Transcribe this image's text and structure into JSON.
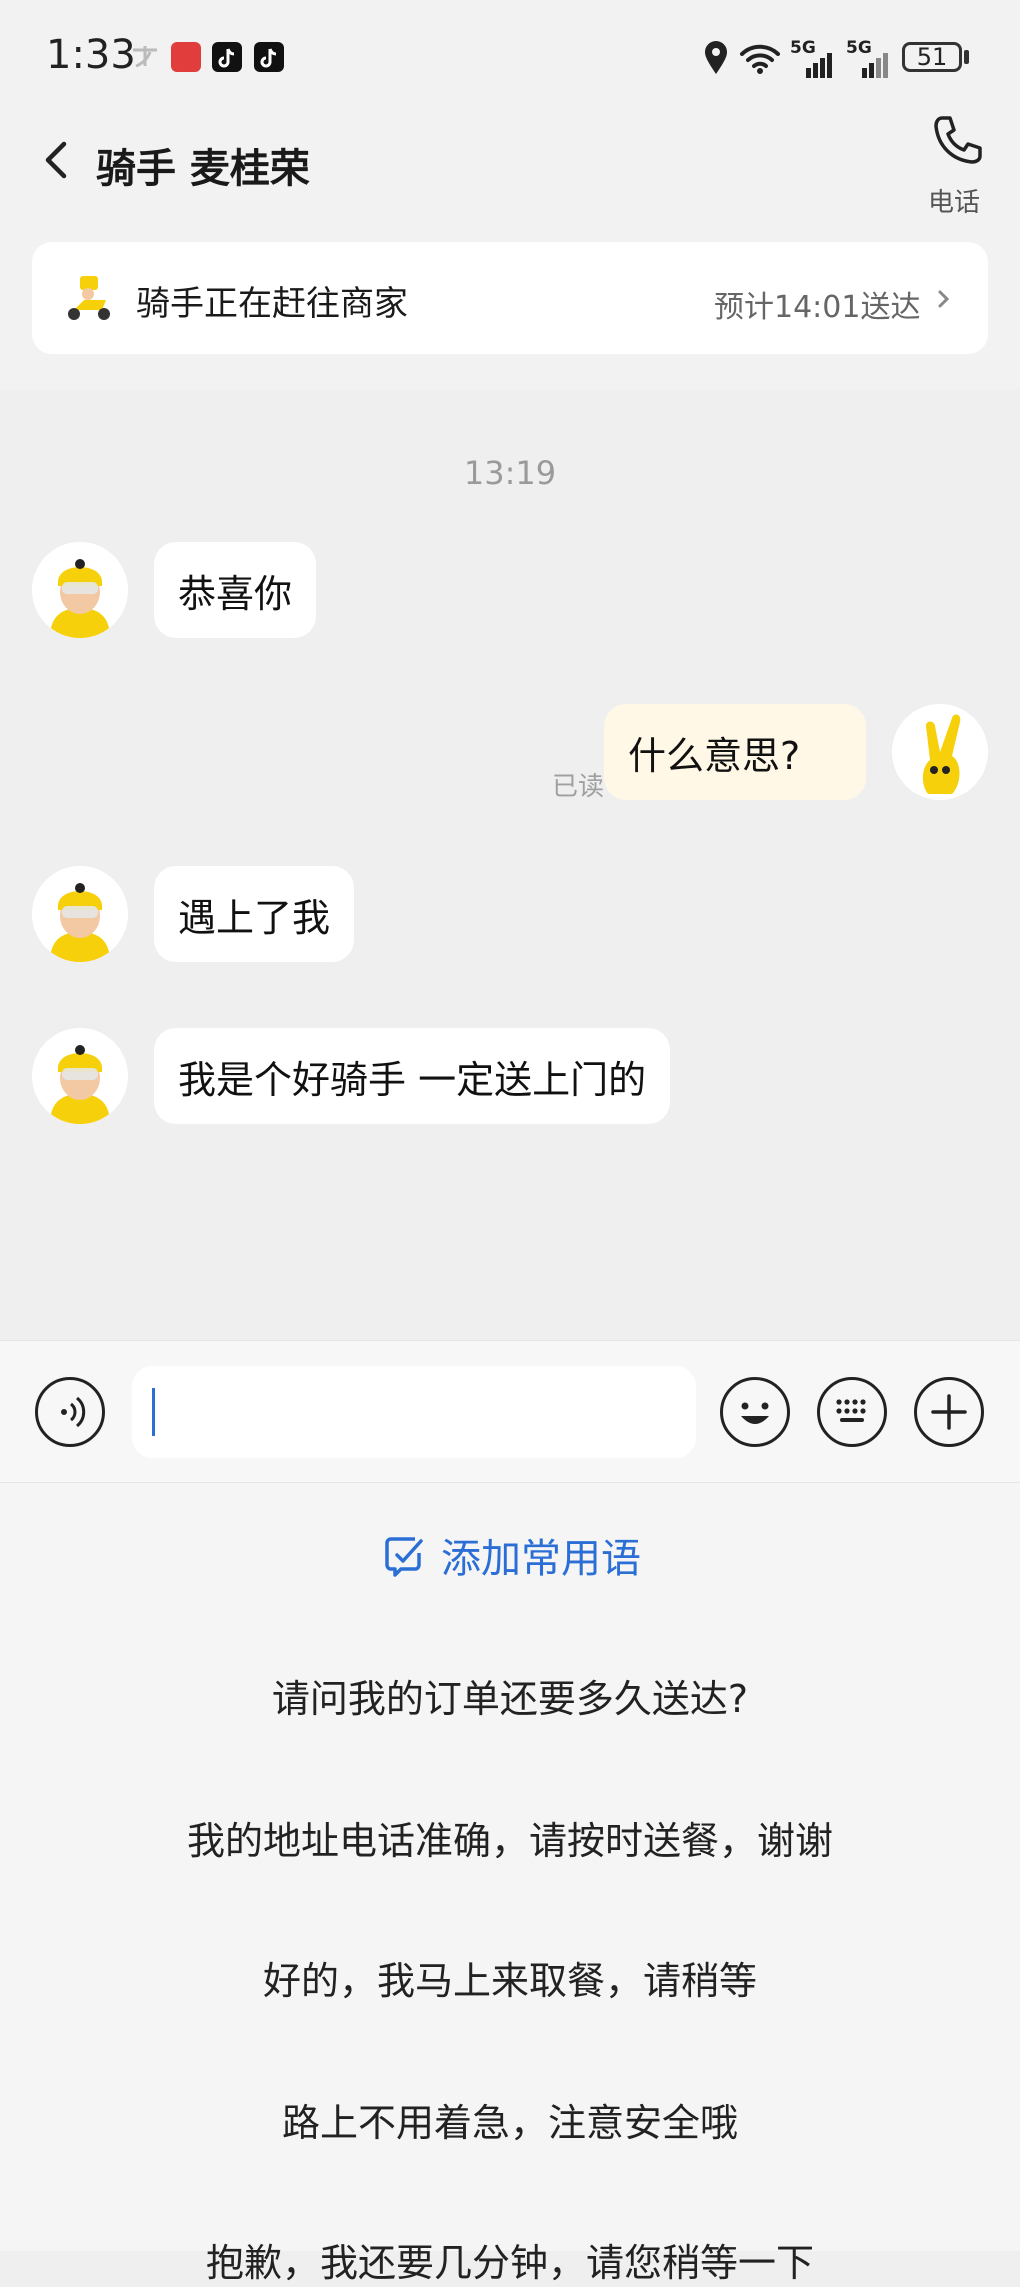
{
  "status_bar": {
    "time": "1:33",
    "network_1": "5G",
    "network_2": "5G",
    "battery": "51"
  },
  "header": {
    "title": "骑手 麦桂荣",
    "phone_label": "电话"
  },
  "order_status": {
    "text": "骑手正在赶往商家",
    "eta": "预计14:01送达"
  },
  "chat": {
    "timestamp": "13:19",
    "messages": [
      {
        "from": "rider",
        "text": "恭喜你"
      },
      {
        "from": "me",
        "text": "什么意思?",
        "read_label": "已读"
      },
      {
        "from": "rider",
        "text": "遇上了我"
      },
      {
        "from": "rider",
        "text": "我是个好骑手 一定送上门的"
      }
    ]
  },
  "input": {
    "value": "",
    "placeholder": ""
  },
  "quick_phrases": {
    "add_label": "添加常用语",
    "items": [
      "请问我的订单还要多久送达?",
      "我的地址电话准确，请按时送餐，谢谢",
      "好的，我马上来取餐，请稍等",
      "路上不用着急，注意安全哦",
      "抱歉，我还要几分钟，请您稍等一下"
    ]
  },
  "colors": {
    "accent_blue": "#2b6fd6",
    "rider_yellow": "#f6d10b",
    "my_bubble": "#fff8e6"
  },
  "icons": [
    "back-arrow-icon",
    "phone-icon",
    "scooter-icon",
    "chevron-right-icon",
    "voice-icon",
    "emoji-icon",
    "keyboard-icon",
    "plus-icon",
    "edit-icon"
  ]
}
